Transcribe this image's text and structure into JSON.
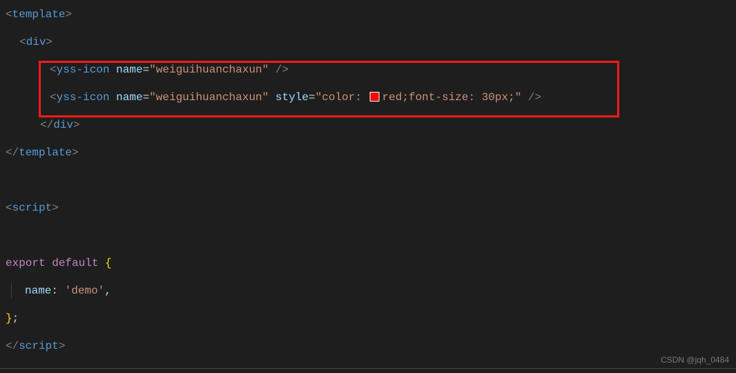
{
  "code": {
    "tpl_open": "template",
    "div_open": "div",
    "comp1": {
      "tag": "yss-icon",
      "attr_name": "name",
      "attr_val": "\"weiguihuanchaxun\""
    },
    "comp2": {
      "tag": "yss-icon",
      "attr_name": "name",
      "attr_val": "\"weiguihuanchaxun\"",
      "style_attr": "style",
      "style_prefix": "\"color: ",
      "style_color_word": "red",
      "style_suffix": ";font-size: 30px;\""
    },
    "div_close": "div",
    "tpl_close": "template",
    "script_open": "script",
    "export": "export",
    "default": "default",
    "brace_open": "{",
    "name_key": "name",
    "colon": ":",
    "name_val": "'demo'",
    "comma": ",",
    "brace_close": "}",
    "semi": ";",
    "script_close": "script"
  },
  "watermark": "CSDN @jqh_0484"
}
